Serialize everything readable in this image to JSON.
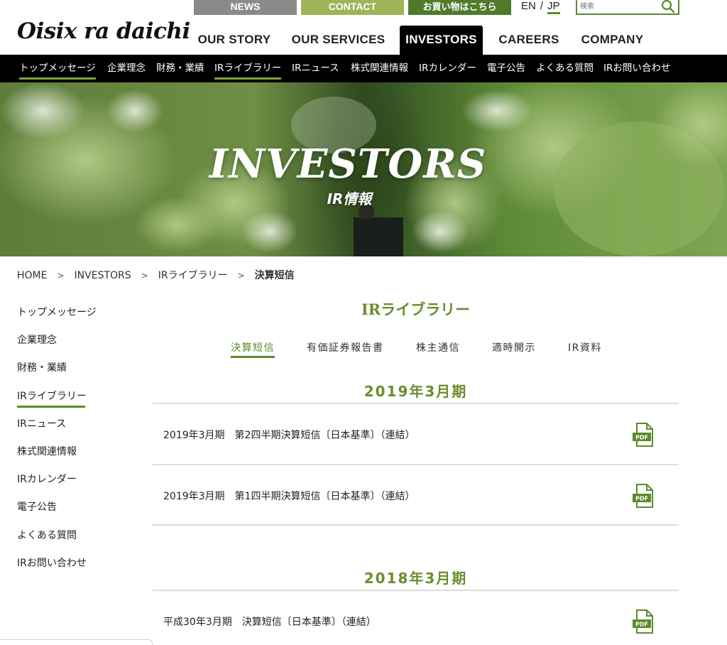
{
  "header": {
    "logo": "Oisix ra daichi",
    "utility": {
      "news": "NEWS",
      "contact": "CONTACT",
      "shop": "お買い物はこちら"
    },
    "lang": {
      "en": "EN",
      "sep": "/",
      "jp": "JP"
    },
    "search_placeholder": "検索",
    "nav": [
      "OUR STORY",
      "OUR SERVICES",
      "INVESTORS",
      "CAREERS",
      "COMPANY"
    ],
    "active_nav": "INVESTORS"
  },
  "subnav": [
    "トップメッセージ",
    "企業理念",
    "財務・業績",
    "IRライブラリー",
    "IRニュース",
    "株式関連情報",
    "IRカレンダー",
    "電子公告",
    "よくある質問",
    "IRお問い合わせ"
  ],
  "hero": {
    "title": "INVESTORS",
    "subtitle": "IR情報"
  },
  "breadcrumb": [
    "HOME",
    "INVESTORS",
    "IRライブラリー",
    "決算短信"
  ],
  "breadcrumb_sep": ">",
  "side_menu": [
    "トップメッセージ",
    "企業理念",
    "財務・業績",
    "IRライブラリー",
    "IRニュース",
    "株式関連情報",
    "IRカレンダー",
    "電子公告",
    "よくある質問",
    "IRお問い合わせ"
  ],
  "main": {
    "title": "IRライブラリー",
    "tabs": [
      "決算短信",
      "有価証券報告書",
      "株主通信",
      "適時開示",
      "IR資料"
    ],
    "sections": [
      {
        "year": "2019年3月期",
        "items": [
          "2019年3月期　第2四半期決算短信〔日本基準〕（連結）",
          "2019年3月期　第1四半期決算短信〔日本基準〕（連結）"
        ]
      },
      {
        "year": "2018年3月期",
        "items": [
          "平成30年3月期　決算短信〔日本基準〕（連結）"
        ]
      }
    ],
    "pdf_label": "PDF"
  },
  "colors": {
    "accent": "#5c8a2a",
    "contact": "#9db556",
    "news": "#8a8a8a",
    "shop": "#4e7a2a"
  }
}
